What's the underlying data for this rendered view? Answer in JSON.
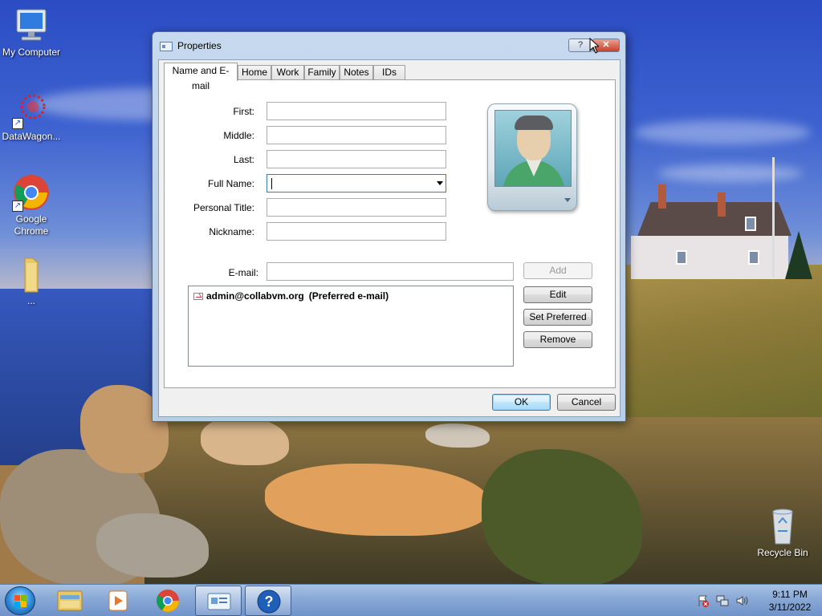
{
  "desktop": {
    "icons": [
      {
        "label": "My Computer"
      },
      {
        "label": "DataWagon..."
      },
      {
        "label": "Google Chrome"
      },
      {
        "label": "..."
      },
      {
        "label": "Recycle Bin"
      }
    ]
  },
  "dialog": {
    "title": "Properties",
    "help_glyph": "?",
    "close_glyph": "✕",
    "tabs": [
      {
        "label": "Name and E-mail",
        "active": true
      },
      {
        "label": "Home"
      },
      {
        "label": "Work"
      },
      {
        "label": "Family"
      },
      {
        "label": "Notes"
      },
      {
        "label": "IDs"
      }
    ],
    "fields": {
      "first": {
        "label": "First:",
        "value": ""
      },
      "middle": {
        "label": "Middle:",
        "value": ""
      },
      "last": {
        "label": "Last:",
        "value": ""
      },
      "full_name": {
        "label": "Full Name:",
        "value": ""
      },
      "personal_title": {
        "label": "Personal Title:",
        "value": ""
      },
      "nickname": {
        "label": "Nickname:",
        "value": ""
      },
      "email": {
        "label": "E-mail:",
        "value": ""
      }
    },
    "email_list": [
      {
        "address": "admin@collabvm.org",
        "note": "(Preferred e-mail)"
      }
    ],
    "buttons": {
      "add": "Add",
      "edit": "Edit",
      "set_preferred": "Set Preferred",
      "remove": "Remove",
      "ok": "OK",
      "cancel": "Cancel"
    }
  },
  "taskbar": {
    "clock": {
      "time": "9:11 PM",
      "date": "3/11/2022"
    }
  },
  "colors": {
    "accent": "#3c7fb1",
    "close_button": "#c9412b"
  }
}
